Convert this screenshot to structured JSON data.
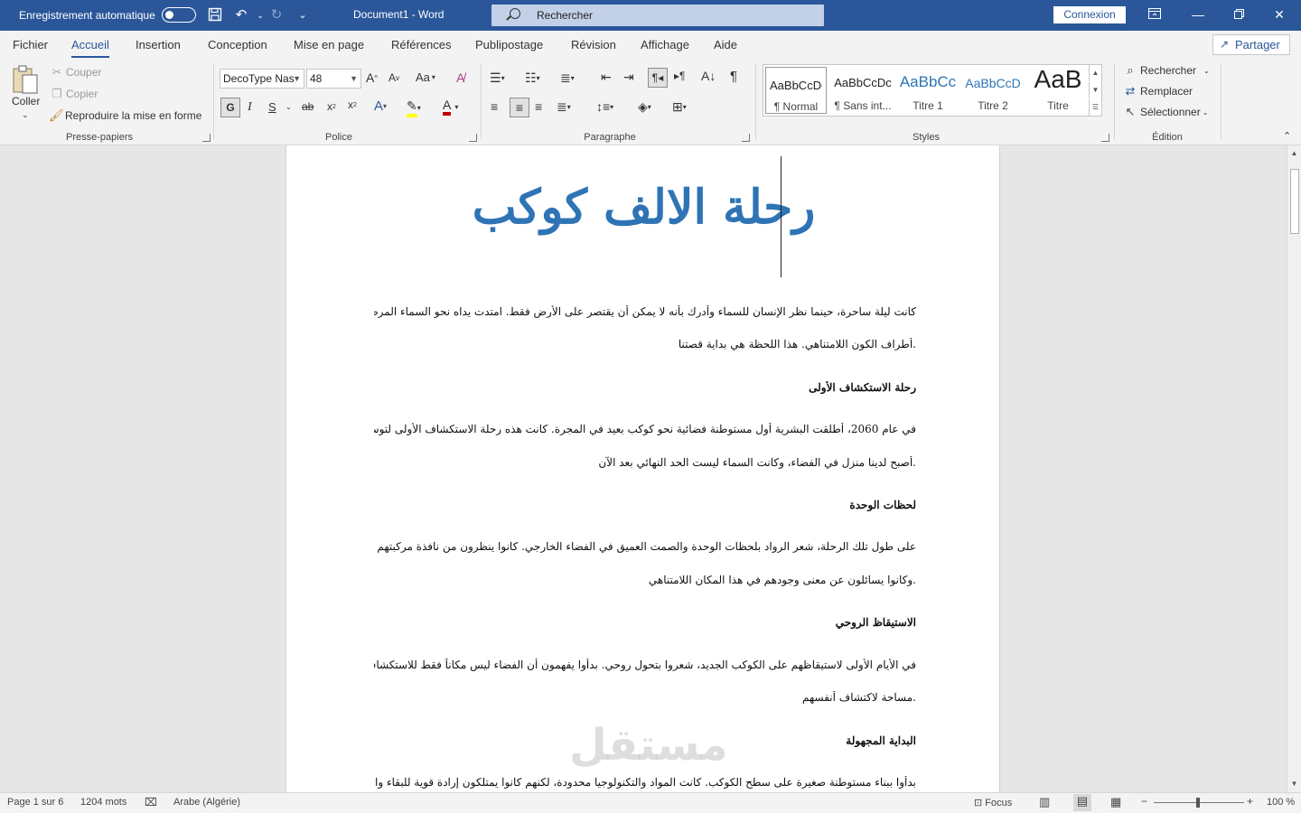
{
  "titlebar": {
    "autosave_label": "Enregistrement automatique",
    "document_title": "Document1  -  Word",
    "search_placeholder": "Rechercher",
    "signin_label": "Connexion"
  },
  "menu": {
    "tabs": [
      "Fichier",
      "Accueil",
      "Insertion",
      "Conception",
      "Mise en page",
      "Références",
      "Publipostage",
      "Révision",
      "Affichage",
      "Aide"
    ],
    "active": "Accueil",
    "share_label": "Partager"
  },
  "ribbon": {
    "clipboard": {
      "label": "Presse-papiers",
      "paste": "Coller",
      "cut": "Couper",
      "copy": "Copier",
      "format_painter": "Reproduire la mise en forme"
    },
    "font": {
      "label": "Police",
      "font_name": "DecoType Nas",
      "font_size": "48",
      "bold": "G",
      "italic": "I",
      "underline": "S"
    },
    "paragraph": {
      "label": "Paragraphe"
    },
    "styles": {
      "label": "Styles",
      "items": [
        {
          "sample": "AaBbCcDc",
          "name": "¶ Normal"
        },
        {
          "sample": "AaBbCcDc",
          "name": "¶ Sans int..."
        },
        {
          "sample": "AaBbCc",
          "name": "Titre 1"
        },
        {
          "sample": "AaBbCcD",
          "name": "Titre 2"
        },
        {
          "sample": "AaB",
          "name": "Titre"
        }
      ]
    },
    "editing": {
      "label": "Édition",
      "find": "Rechercher",
      "replace": "Remplacer",
      "select": "Sélectionner"
    }
  },
  "document": {
    "title": "رحلة الالف كوكب",
    "lines": [
      {
        "text": "كانت ليلة ساحرة، حينما نظر الإنسان للسماء وأدرك بأنه لا يمكن أن يقتصر على الأرض فقط. امتدت يداه نحو السماء المرصعة بالنجوم، محاولاً لمس",
        "type": "p"
      },
      {
        "text": ".أطراف الكون اللامتناهي. هذا اللحظة هي بداية قصتنا",
        "type": "p"
      },
      {
        "text": "رحلة الاستكشاف الأولى",
        "type": "head"
      },
      {
        "text": "في عام 2060، أطلقت البشرية أول مستوطنة فضائية نحو كوكب بعيد في المجرة. كانت هذه رحلة الاستكشاف الأولى لتوسيع حدود الإنسانية.",
        "type": "p"
      },
      {
        "text": ".أصبح لدينا منزل في الفضاء، وكانت السماء ليست الحد النهائي بعد الآن",
        "type": "p"
      },
      {
        "text": "لحظات الوحدة",
        "type": "head"
      },
      {
        "text": "على طول تلك الرحلة، شعر الرواد بلحظات الوحدة والصمت العميق في الفضاء الخارجي. كانوا ينظرون من نافذة مركبتهم إلى الكواكب والنجوم،",
        "type": "p"
      },
      {
        "text": ".وكانوا يسائلون عن معنى وجودهم في هذا المكان اللامتناهي",
        "type": "p"
      },
      {
        "text": "الاستيقاظ الروحي",
        "type": "head"
      },
      {
        "text": "في الأيام الأولى لاستيقاظهم على الكوكب الجديد، شعروا بتحول روحي. بدأوا يفهمون أن الفضاء ليس مكاناً فقط للاستكشاف العلمي، بل أيضاً",
        "type": "p"
      },
      {
        "text": ".مساحة لاكتشاف أنفسهم",
        "type": "p"
      },
      {
        "text": "البداية المجهولة",
        "type": "head"
      },
      {
        "text": "بدأوا ببناء مستوطنة صغيرة على سطح الكوكب. كانت المواد والتكنولوجيا محدودة، لكنهم كانوا يمتلكون إرادة قوية للبقاء والنمو. هذه البداية كانت",
        "type": "p"
      }
    ],
    "watermark": "مستقل"
  },
  "statusbar": {
    "page": "Page 1 sur 6",
    "words": "1204 mots",
    "language": "Arabe (Algérie)",
    "focus": "Focus",
    "zoom": "100 %"
  },
  "colors": {
    "brand": "#2b579a",
    "heading": "#2e74b5"
  }
}
